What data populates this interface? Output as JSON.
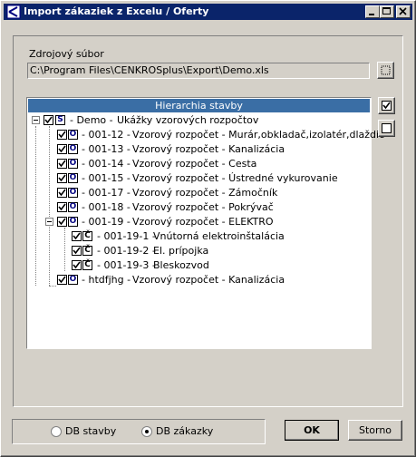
{
  "window": {
    "title": "Import zákaziek z Excelu / Oferty"
  },
  "source": {
    "label": "Zdrojový súbor",
    "path": "C:\\Program Files\\CENKROSplus\\Export\\Demo.xls"
  },
  "tree": {
    "header": "Hierarchia stavby",
    "root": {
      "badge": "S",
      "code": "- Demo -",
      "name": "Ukážky vzorových rozpočtov"
    },
    "items": [
      {
        "badge": "O",
        "code": "- 001-12 -",
        "name": "Vzorový rozpočet - Murár,obkladač,izolatér,dlaždič"
      },
      {
        "badge": "O",
        "code": "- 001-13 -",
        "name": "Vzorový rozpočet - Kanalizácia"
      },
      {
        "badge": "O",
        "code": "- 001-14 -",
        "name": "Vzorový rozpočet - Cesta"
      },
      {
        "badge": "O",
        "code": "- 001-15 -",
        "name": "Vzorový rozpočet - Ústredné vykurovanie"
      },
      {
        "badge": "O",
        "code": "- 001-17 -",
        "name": "Vzorový rozpočet - Zámočník"
      },
      {
        "badge": "O",
        "code": "- 001-18 -",
        "name": "Vzorový rozpočet - Pokrývač"
      },
      {
        "badge": "O",
        "code": "- 001-19 -",
        "name": "Vzorový rozpočet - ELEKTRO"
      }
    ],
    "subitems": [
      {
        "badge": "Č",
        "code": "- 001-19-1 -",
        "name": "Vnútorná elektroinštalácia"
      },
      {
        "badge": "Č",
        "code": "- 001-19-2 -",
        "name": "El. prípojka"
      },
      {
        "badge": "Č",
        "code": "- 001-19-3 -",
        "name": "Bleskozvod"
      }
    ],
    "last": {
      "badge": "O",
      "code": "- htdfjhg -",
      "name": "Vzorový rozpočet - Kanalizácia"
    }
  },
  "db": {
    "option1": "DB stavby",
    "option2": "DB zákazky",
    "selected": "DB zákazky"
  },
  "buttons": {
    "ok": "OK",
    "cancel": "Storno"
  }
}
